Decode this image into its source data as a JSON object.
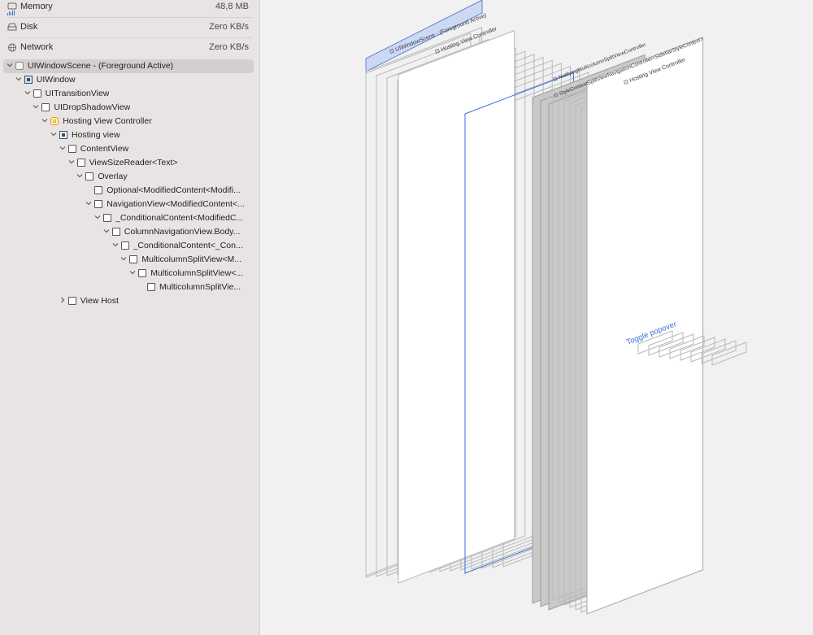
{
  "gauges": {
    "memory": {
      "label": "Memory",
      "value": "48,8 MB",
      "icon": "memory-icon"
    },
    "disk": {
      "label": "Disk",
      "value": "Zero KB/s",
      "icon": "disk-icon"
    },
    "network": {
      "label": "Network",
      "value": "Zero KB/s",
      "icon": "network-icon"
    }
  },
  "tree": [
    {
      "label": "UIWindowScene - (Foreground Active)",
      "depth": 0,
      "expanded": true,
      "icon": "scene",
      "selected": true
    },
    {
      "label": "UIWindow",
      "depth": 1,
      "expanded": true,
      "icon": "window"
    },
    {
      "label": "UITransitionView",
      "depth": 2,
      "expanded": true,
      "icon": "view"
    },
    {
      "label": "UIDropShadowView",
      "depth": 3,
      "expanded": true,
      "icon": "view"
    },
    {
      "label": "Hosting View Controller",
      "depth": 4,
      "expanded": true,
      "icon": "vc"
    },
    {
      "label": "Hosting view",
      "depth": 5,
      "expanded": true,
      "icon": "hosting"
    },
    {
      "label": "ContentView",
      "depth": 6,
      "expanded": true,
      "icon": "view"
    },
    {
      "label": "ViewSizeReader<Text>",
      "depth": 7,
      "expanded": true,
      "icon": "view"
    },
    {
      "label": "Overlay",
      "depth": 8,
      "expanded": true,
      "icon": "view"
    },
    {
      "label": "Optional<ModifiedContent<Modifi...",
      "depth": 9,
      "expanded": null,
      "icon": "view"
    },
    {
      "label": "NavigationView<ModifiedContent<...",
      "depth": 9,
      "expanded": true,
      "icon": "view"
    },
    {
      "label": "_ConditionalContent<ModifiedC...",
      "depth": 10,
      "expanded": true,
      "icon": "view"
    },
    {
      "label": "ColumnNavigationView.Body...",
      "depth": 11,
      "expanded": true,
      "icon": "view"
    },
    {
      "label": "_ConditionalContent<_Con...",
      "depth": 12,
      "expanded": true,
      "icon": "view"
    },
    {
      "label": "MulticolumnSplitView<M...",
      "depth": 13,
      "expanded": true,
      "icon": "view"
    },
    {
      "label": "MulticolumnSplitView<...",
      "depth": 14,
      "expanded": true,
      "icon": "view"
    },
    {
      "label": "MulticolumnSplitVie...",
      "depth": 15,
      "expanded": null,
      "icon": "view"
    },
    {
      "label": "View Host",
      "depth": 6,
      "expanded": false,
      "icon": "view"
    }
  ],
  "canvas": {
    "scene_label": "UIWindowScene - (Foreground Active)",
    "hosting_label": "Hosting View Controller",
    "nav_label": "NotifyingMulticolumnSplitViewController",
    "style_label": "StyleContextSplitViewNavigationController<SidebarStyleContext>",
    "inner_hosting_label": "Hosting View Controller",
    "toggle_label": "Toggle popover",
    "accent": "#3a6fd8",
    "outline": "#b9b9b9",
    "gray_fill": "#c9c9ca"
  }
}
